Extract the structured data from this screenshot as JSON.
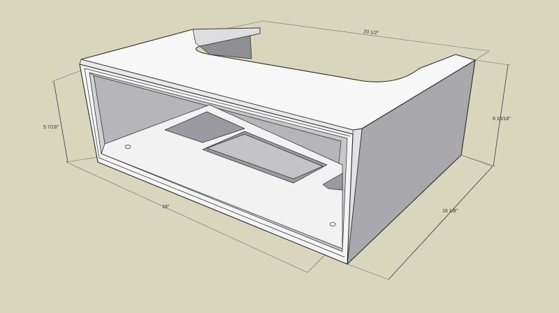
{
  "dimensions": {
    "width_top": "20 1/2\"",
    "height_front": "5 7/16\"",
    "height_side": "6 15/16\"",
    "width_front": "19\"",
    "depth_side": "16 1/8\""
  },
  "colors": {
    "background": "#d8d6bd",
    "top_face": "#f7f7f7",
    "side_face": "#a9a9ad",
    "interior_wall": "#c7c7cc",
    "interior_back": "#b5b5ba",
    "floor": "#f2f2f2",
    "edge": "#2b2b2b"
  }
}
